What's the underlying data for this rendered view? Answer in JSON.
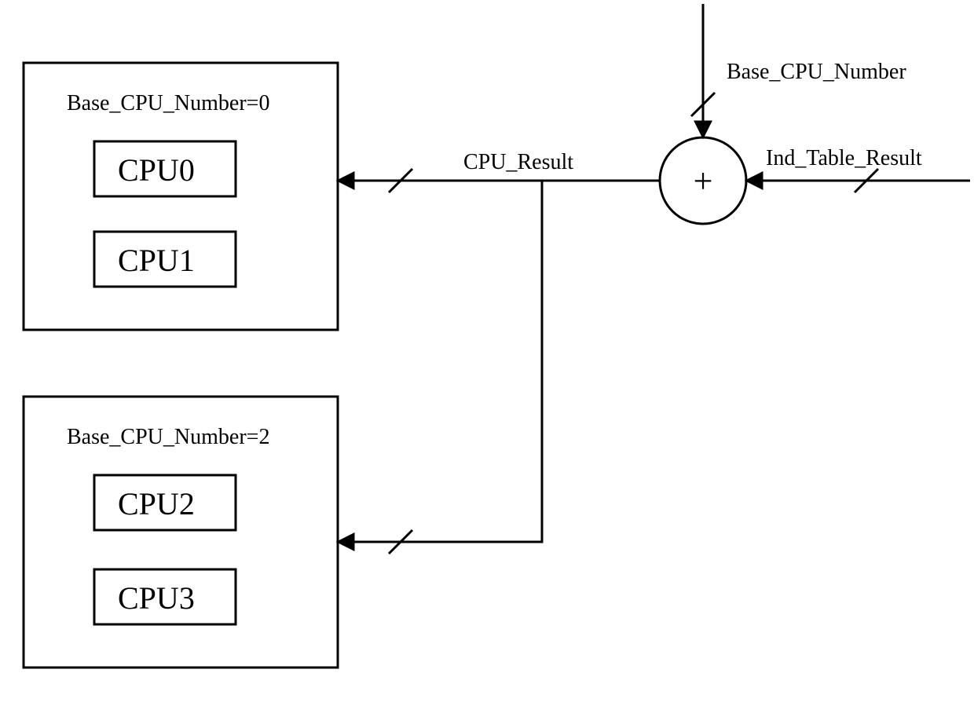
{
  "topGroup": {
    "header": "Base_CPU_Number=0",
    "cpu0": "CPU0",
    "cpu1": "CPU1"
  },
  "bottomGroup": {
    "header": "Base_CPU_Number=2",
    "cpu2": "CPU2",
    "cpu3": "CPU3"
  },
  "adder": {
    "symbol": "+"
  },
  "signals": {
    "topInput": "Base_CPU_Number",
    "rightInput": "Ind_Table_Result",
    "output": "CPU_Result"
  }
}
